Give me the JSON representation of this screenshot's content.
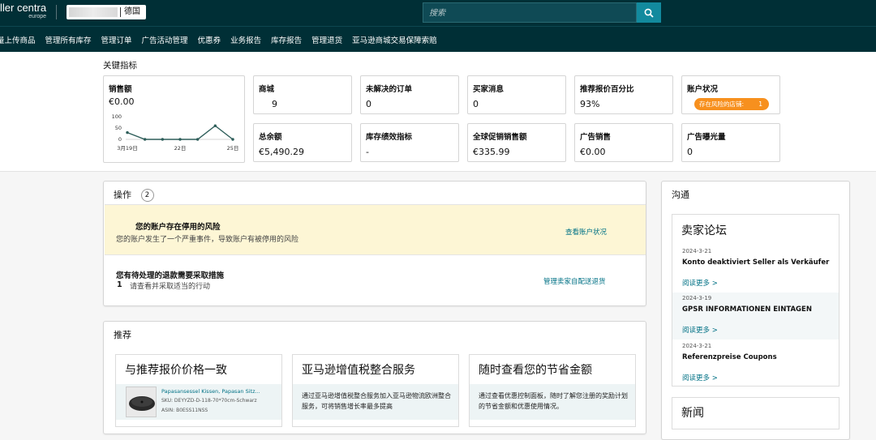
{
  "header": {
    "brand_name": "ller centra",
    "brand_sub": "europe",
    "marketplace_label": "德国",
    "search_placeholder": "搜索"
  },
  "nav": {
    "items": [
      "量上传商品",
      "管理所有库存",
      "管理订单",
      "广告活动管理",
      "优惠券",
      "业务报告",
      "库存报告",
      "管理退货",
      "亚马逊商城交易保障索赔"
    ]
  },
  "metrics": {
    "title": "关键指标",
    "sales": {
      "label": "销售额",
      "value": "€0.00"
    },
    "cards": {
      "mall": {
        "label": "商城",
        "value": "9"
      },
      "open_orders": {
        "label": "未解决的订单",
        "value": "0"
      },
      "buyer_messages": {
        "label": "买家消息",
        "value": "0"
      },
      "featured_offer": {
        "label": "推荐报价百分比",
        "value": "93%"
      },
      "account_status": {
        "label": "账户状况",
        "pill_text": "存在风险的店铺:",
        "pill_count": "1"
      },
      "total_balance": {
        "label": "总余额",
        "value": "€5,490.29"
      },
      "inventory_perf": {
        "label": "库存绩效指标",
        "value": "-"
      },
      "global_promo": {
        "label": "全球促销销售额",
        "value": "€335.99"
      },
      "ad_sales": {
        "label": "广告销售",
        "value": "€0.00"
      },
      "ad_impressions": {
        "label": "广告曝光量",
        "value": "0"
      }
    }
  },
  "chart_data": {
    "type": "line",
    "x": [
      19,
      20,
      21,
      22,
      23,
      24,
      25
    ],
    "values": [
      30,
      0,
      0,
      0,
      0,
      60,
      0
    ],
    "y_ticks": [
      "100",
      "50",
      "0"
    ],
    "x_tick_labels": [
      "3月19日",
      "22日",
      "25日"
    ],
    "x_tick_positions": [
      19,
      22,
      25
    ],
    "ylim": [
      0,
      100
    ],
    "series_color": "#2e5e5a"
  },
  "actions": {
    "title": "操作",
    "count": "2",
    "items": [
      {
        "title": "您的账户存在停用的风险",
        "desc": "您的账户发生了一个严重事件，导致账户有被停用的风险",
        "link": "查看账户状况"
      },
      {
        "title": "您有待处理的退款需要采取措施",
        "count": "1",
        "desc": "请查看并采取适当的行动",
        "link": "管理卖家自配送退货"
      }
    ]
  },
  "recommend": {
    "title": "推荐",
    "cards": [
      {
        "title": "与推荐报价价格一致",
        "product_name": "Papasansessel Kissen, Papasan Sitz...",
        "sku": "SKU: DEYYZD-D-118-70*70cm-Schwarz",
        "asin": "ASIN: B0ESS11NSS"
      },
      {
        "title": "亚马逊增值税整合服务",
        "text": "通过亚马逊增值税整合服务加入亚马逊物流欧洲整合服务，可将销售增长率最多提高"
      },
      {
        "title": "随时查看您的节省金额",
        "text": "通过查看优惠控制面板，随时了解您注册的奖励计划的节省金额和优惠使用情况。"
      }
    ]
  },
  "communication": {
    "title": "沟通",
    "forum_title": "卖家论坛",
    "posts": [
      {
        "date": "2024-3-21",
        "title": "Konto deaktiviert Seller als Verkäufer",
        "link": "阅读更多 >"
      },
      {
        "date": "2024-3-19",
        "title": "GPSR INFORMATIONEN EINTAGEN",
        "link": "阅读更多 >"
      },
      {
        "date": "2024-3-21",
        "title": "Referenzpreise Coupons",
        "link": "阅读更多 >"
      }
    ],
    "news_title": "新闻"
  },
  "colors": {
    "header_bg": "#002f36",
    "search_btn": "#128a9e",
    "link": "#007185",
    "alert_bg": "#fdf6d5",
    "status_pill": "#f7901e"
  }
}
